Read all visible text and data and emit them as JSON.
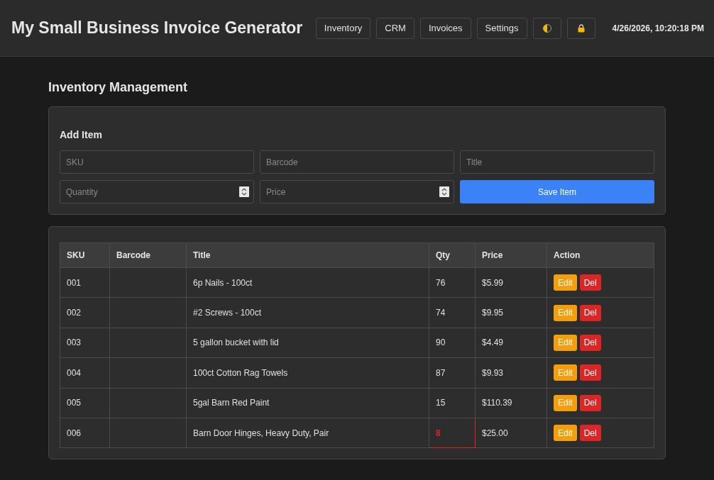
{
  "header": {
    "title": "My Small Business Invoice Generator",
    "nav": [
      {
        "label": "Inventory"
      },
      {
        "label": "CRM"
      },
      {
        "label": "Invoices"
      },
      {
        "label": "Settings"
      }
    ],
    "tools": [
      {
        "kind": "theme"
      },
      {
        "kind": "lock"
      }
    ],
    "datetime": "4/26/2026, 10:20:18 PM"
  },
  "page_title": "Inventory Management",
  "add_item": {
    "title": "Add Item",
    "fields": [
      {
        "placeholder": "SKU",
        "kind": "text"
      },
      {
        "placeholder": "Barcode",
        "kind": "text"
      },
      {
        "placeholder": "Title",
        "kind": "text"
      },
      {
        "placeholder": "Quantity",
        "kind": "number"
      },
      {
        "placeholder": "Price",
        "kind": "number"
      }
    ],
    "save_button": "Save Item"
  },
  "table": {
    "columns": [
      "SKU",
      "Barcode",
      "Title",
      "Qty",
      "Price",
      "Action"
    ],
    "rows": [
      {
        "sku": "001",
        "title": "6p Nails - 100ct",
        "qty": "76",
        "price": "$5.99",
        "low_stock": false,
        "actions": [
          {
            "label": "Edit",
            "kind": "edit"
          },
          {
            "label": "Del",
            "kind": "delete"
          }
        ]
      },
      {
        "sku": "002",
        "title": "#2 Screws - 100ct",
        "qty": "74",
        "price": "$9.95",
        "low_stock": false,
        "actions": [
          {
            "label": "Edit",
            "kind": "edit"
          },
          {
            "label": "Del",
            "kind": "delete"
          }
        ]
      },
      {
        "sku": "003",
        "title": "5 gallon bucket with lid",
        "qty": "90",
        "price": "$4.49",
        "low_stock": false,
        "actions": [
          {
            "label": "Edit",
            "kind": "edit"
          },
          {
            "label": "Del",
            "kind": "delete"
          }
        ]
      },
      {
        "sku": "004",
        "title": "100ct Cotton Rag Towels",
        "qty": "87",
        "price": "$9.93",
        "low_stock": false,
        "actions": [
          {
            "label": "Edit",
            "kind": "edit"
          },
          {
            "label": "Del",
            "kind": "delete"
          }
        ]
      },
      {
        "sku": "005",
        "title": "5gal Barn Red Paint",
        "qty": "15",
        "price": "$110.39",
        "low_stock": false,
        "actions": [
          {
            "label": "Edit",
            "kind": "edit"
          },
          {
            "label": "Del",
            "kind": "delete"
          }
        ]
      },
      {
        "sku": "006",
        "title": "Barn Door Hinges, Heavy Duty, Pair",
        "qty": "8",
        "price": "$25.00",
        "low_stock": true,
        "actions": [
          {
            "label": "Edit",
            "kind": "edit"
          },
          {
            "label": "Del",
            "kind": "delete"
          }
        ]
      }
    ]
  }
}
